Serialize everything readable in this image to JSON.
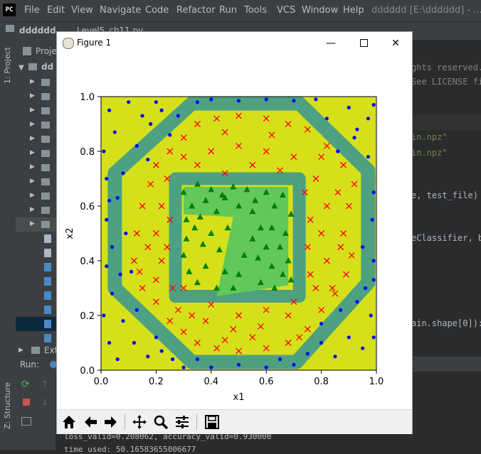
{
  "ide": {
    "logo": "PC",
    "menu": [
      "File",
      "Edit",
      "View",
      "Navigate",
      "Code",
      "Refactor",
      "Run",
      "Tools",
      "VCS",
      "Window",
      "Help"
    ],
    "title": "dddddd [E:\\dddddd] - ...\\",
    "breadcrumb_project": "dddddd",
    "breadcrumb_file": "Level5_ch11.py",
    "sidebar_labels": {
      "project": "1: Project",
      "structure": "Z: Structure"
    },
    "project_header": "Proje",
    "tree_root": "dd",
    "tree_ext": "Ext",
    "run_label": "Run:",
    "code_lines": [
      "ghts reserved.",
      "See LICENSE fi",
      "in.npz\"",
      "in.npz\"",
      "e, test_file)",
      "eClassifier, ba",
      "ain.shape[0]):"
    ],
    "console_lines": [
      "loss_valid=0.208062, accuracy_valid=0.930000",
      "time used: 50.16583655006677"
    ]
  },
  "figure": {
    "window_title": "Figure 1",
    "controls": {
      "minimize": "minimize-icon",
      "maximize": "maximize-icon",
      "close": "close-icon"
    },
    "toolbar_icons": [
      "home-icon",
      "back-arrow-icon",
      "forward-arrow-icon",
      "pan-move-icon",
      "zoom-magnifier-icon",
      "configure-subplots-icon",
      "save-disk-icon"
    ],
    "colors": {
      "background_region": "#d6e01a",
      "ring_region": "#3e9a8c",
      "inner_region": "#62c85a",
      "class_outer": "#0000ff",
      "class_middle": "#ff0000",
      "class_inner": "#008000"
    }
  },
  "chart_data": {
    "type": "scatter",
    "title": "",
    "xlabel": "x1",
    "ylabel": "x2",
    "xlim": [
      0.0,
      1.0
    ],
    "ylim": [
      0.0,
      1.0
    ],
    "xticks": [
      "0.0",
      "0.2",
      "0.4",
      "0.6",
      "0.8",
      "1.0"
    ],
    "yticks": [
      "0.0",
      "0.2",
      "0.4",
      "0.6",
      "0.8",
      "1.0"
    ],
    "grid": false,
    "legend": "none",
    "series": [
      {
        "marker": "dot",
        "color": "#0000ff",
        "region": "outside octagon"
      },
      {
        "marker": "x",
        "color": "#ff0000",
        "region": "between octagon and square"
      },
      {
        "marker": "triangle",
        "color": "#008000",
        "region": "inside square"
      }
    ],
    "regions": {
      "octagon": [
        [
          0.33,
          0.975
        ],
        [
          0.72,
          0.975
        ],
        [
          0.97,
          0.73
        ],
        [
          0.97,
          0.32
        ],
        [
          0.71,
          0.03
        ],
        [
          0.33,
          0.03
        ],
        [
          0.05,
          0.3
        ],
        [
          0.05,
          0.72
        ]
      ],
      "square": [
        [
          0.27,
          0.7
        ],
        [
          0.72,
          0.7
        ],
        [
          0.72,
          0.27
        ],
        [
          0.27,
          0.27
        ]
      ],
      "inner_lobe": [
        [
          0.3,
          0.67
        ],
        [
          0.68,
          0.67
        ],
        [
          0.68,
          0.31
        ],
        [
          0.42,
          0.27
        ],
        [
          0.48,
          0.56
        ],
        [
          0.3,
          0.57
        ]
      ]
    },
    "points": {
      "dots": [
        [
          0.03,
          0.95
        ],
        [
          0.05,
          0.87
        ],
        [
          0.1,
          0.98
        ],
        [
          0.13,
          0.82
        ],
        [
          0.18,
          0.9
        ],
        [
          0.22,
          0.95
        ],
        [
          0.25,
          0.86
        ],
        [
          0.17,
          0.77
        ],
        [
          0.08,
          0.72
        ],
        [
          0.03,
          0.62
        ],
        [
          0.02,
          0.55
        ],
        [
          0.04,
          0.45
        ],
        [
          0.02,
          0.38
        ],
        [
          0.04,
          0.28
        ],
        [
          0.08,
          0.18
        ],
        [
          0.03,
          0.1
        ],
        [
          0.06,
          0.04
        ],
        [
          0.12,
          0.1
        ],
        [
          0.17,
          0.05
        ],
        [
          0.2,
          0.12
        ],
        [
          0.26,
          0.04
        ],
        [
          0.3,
          0.01
        ],
        [
          0.4,
          0.01
        ],
        [
          0.5,
          0.02
        ],
        [
          0.6,
          0.01
        ],
        [
          0.7,
          0.02
        ],
        [
          0.75,
          0.06
        ],
        [
          0.8,
          0.1
        ],
        [
          0.85,
          0.05
        ],
        [
          0.9,
          0.12
        ],
        [
          0.95,
          0.08
        ],
        [
          0.98,
          0.2
        ],
        [
          0.96,
          0.3
        ],
        [
          0.99,
          0.4
        ],
        [
          0.985,
          0.55
        ],
        [
          0.99,
          0.65
        ],
        [
          0.97,
          0.78
        ],
        [
          0.93,
          0.88
        ],
        [
          0.9,
          0.96
        ],
        [
          0.82,
          0.92
        ],
        [
          0.78,
          0.99
        ],
        [
          0.7,
          0.985
        ],
        [
          0.6,
          0.99
        ],
        [
          0.5,
          0.985
        ],
        [
          0.4,
          0.99
        ],
        [
          0.35,
          0.98
        ],
        [
          0.86,
          0.8
        ],
        [
          0.92,
          0.85
        ],
        [
          0.97,
          0.92
        ],
        [
          0.99,
          0.97
        ],
        [
          0.01,
          0.8
        ],
        [
          0.06,
          0.63
        ],
        [
          0.09,
          0.5
        ],
        [
          0.11,
          0.36
        ],
        [
          0.07,
          0.35
        ],
        [
          0.13,
          0.22
        ],
        [
          0.22,
          0.07
        ],
        [
          0.35,
          0.04
        ],
        [
          0.65,
          0.04
        ],
        [
          0.8,
          0.17
        ],
        [
          0.87,
          0.22
        ],
        [
          0.93,
          0.25
        ],
        [
          0.99,
          0.33
        ],
        [
          0.95,
          0.45
        ],
        [
          0.99,
          0.12
        ],
        [
          0.2,
          0.98
        ],
        [
          0.28,
          0.93
        ],
        [
          0.15,
          0.93
        ],
        [
          0.01,
          0.2
        ],
        [
          0.02,
          0.7
        ]
      ],
      "crosses": [
        [
          0.2,
          0.75
        ],
        [
          0.25,
          0.8
        ],
        [
          0.3,
          0.85
        ],
        [
          0.35,
          0.9
        ],
        [
          0.42,
          0.92
        ],
        [
          0.5,
          0.93
        ],
        [
          0.6,
          0.92
        ],
        [
          0.68,
          0.9
        ],
        [
          0.75,
          0.88
        ],
        [
          0.82,
          0.82
        ],
        [
          0.88,
          0.75
        ],
        [
          0.92,
          0.68
        ],
        [
          0.9,
          0.6
        ],
        [
          0.88,
          0.5
        ],
        [
          0.91,
          0.42
        ],
        [
          0.89,
          0.35
        ],
        [
          0.85,
          0.28
        ],
        [
          0.8,
          0.22
        ],
        [
          0.75,
          0.15
        ],
        [
          0.68,
          0.1
        ],
        [
          0.6,
          0.08
        ],
        [
          0.5,
          0.07
        ],
        [
          0.42,
          0.08
        ],
        [
          0.35,
          0.1
        ],
        [
          0.3,
          0.14
        ],
        [
          0.25,
          0.18
        ],
        [
          0.2,
          0.25
        ],
        [
          0.15,
          0.3
        ],
        [
          0.12,
          0.4
        ],
        [
          0.13,
          0.5
        ],
        [
          0.15,
          0.6
        ],
        [
          0.18,
          0.68
        ],
        [
          0.22,
          0.6
        ],
        [
          0.2,
          0.5
        ],
        [
          0.22,
          0.4
        ],
        [
          0.2,
          0.33
        ],
        [
          0.28,
          0.22
        ],
        [
          0.38,
          0.18
        ],
        [
          0.48,
          0.15
        ],
        [
          0.58,
          0.16
        ],
        [
          0.68,
          0.2
        ],
        [
          0.78,
          0.3
        ],
        [
          0.82,
          0.4
        ],
        [
          0.8,
          0.5
        ],
        [
          0.82,
          0.6
        ],
        [
          0.78,
          0.7
        ],
        [
          0.7,
          0.78
        ],
        [
          0.6,
          0.8
        ],
        [
          0.5,
          0.82
        ],
        [
          0.4,
          0.8
        ],
        [
          0.3,
          0.78
        ],
        [
          0.24,
          0.7
        ],
        [
          0.35,
          0.75
        ],
        [
          0.45,
          0.72
        ],
        [
          0.55,
          0.75
        ],
        [
          0.65,
          0.73
        ],
        [
          0.74,
          0.65
        ],
        [
          0.76,
          0.55
        ],
        [
          0.75,
          0.45
        ],
        [
          0.76,
          0.35
        ],
        [
          0.7,
          0.25
        ],
        [
          0.6,
          0.22
        ],
        [
          0.5,
          0.2
        ],
        [
          0.4,
          0.24
        ],
        [
          0.33,
          0.2
        ],
        [
          0.26,
          0.3
        ],
        [
          0.24,
          0.45
        ],
        [
          0.25,
          0.55
        ],
        [
          0.17,
          0.45
        ],
        [
          0.14,
          0.36
        ],
        [
          0.86,
          0.65
        ],
        [
          0.87,
          0.45
        ],
        [
          0.84,
          0.3
        ],
        [
          0.72,
          0.12
        ],
        [
          0.55,
          0.12
        ],
        [
          0.45,
          0.11
        ],
        [
          0.3,
          0.3
        ],
        [
          0.62,
          0.86
        ],
        [
          0.45,
          0.87
        ],
        [
          0.8,
          0.78
        ]
      ],
      "triangles": [
        [
          0.3,
          0.65
        ],
        [
          0.33,
          0.6
        ],
        [
          0.35,
          0.68
        ],
        [
          0.38,
          0.62
        ],
        [
          0.4,
          0.66
        ],
        [
          0.42,
          0.58
        ],
        [
          0.45,
          0.63
        ],
        [
          0.48,
          0.67
        ],
        [
          0.5,
          0.6
        ],
        [
          0.53,
          0.66
        ],
        [
          0.56,
          0.62
        ],
        [
          0.6,
          0.65
        ],
        [
          0.63,
          0.6
        ],
        [
          0.66,
          0.64
        ],
        [
          0.69,
          0.57
        ],
        [
          0.67,
          0.5
        ],
        [
          0.65,
          0.45
        ],
        [
          0.68,
          0.4
        ],
        [
          0.66,
          0.35
        ],
        [
          0.62,
          0.38
        ],
        [
          0.6,
          0.45
        ],
        [
          0.58,
          0.52
        ],
        [
          0.55,
          0.48
        ],
        [
          0.52,
          0.42
        ],
        [
          0.5,
          0.35
        ],
        [
          0.48,
          0.3
        ],
        [
          0.45,
          0.36
        ],
        [
          0.43,
          0.44
        ],
        [
          0.4,
          0.5
        ],
        [
          0.37,
          0.46
        ],
        [
          0.34,
          0.52
        ],
        [
          0.31,
          0.48
        ],
        [
          0.3,
          0.42
        ],
        [
          0.32,
          0.36
        ],
        [
          0.35,
          0.32
        ],
        [
          0.38,
          0.38
        ],
        [
          0.42,
          0.3
        ],
        [
          0.36,
          0.56
        ],
        [
          0.31,
          0.55
        ],
        [
          0.46,
          0.52
        ],
        [
          0.58,
          0.32
        ],
        [
          0.63,
          0.3
        ],
        [
          0.69,
          0.33
        ],
        [
          0.55,
          0.58
        ],
        [
          0.44,
          0.64
        ],
        [
          0.62,
          0.52
        ],
        [
          0.57,
          0.41
        ]
      ]
    }
  }
}
